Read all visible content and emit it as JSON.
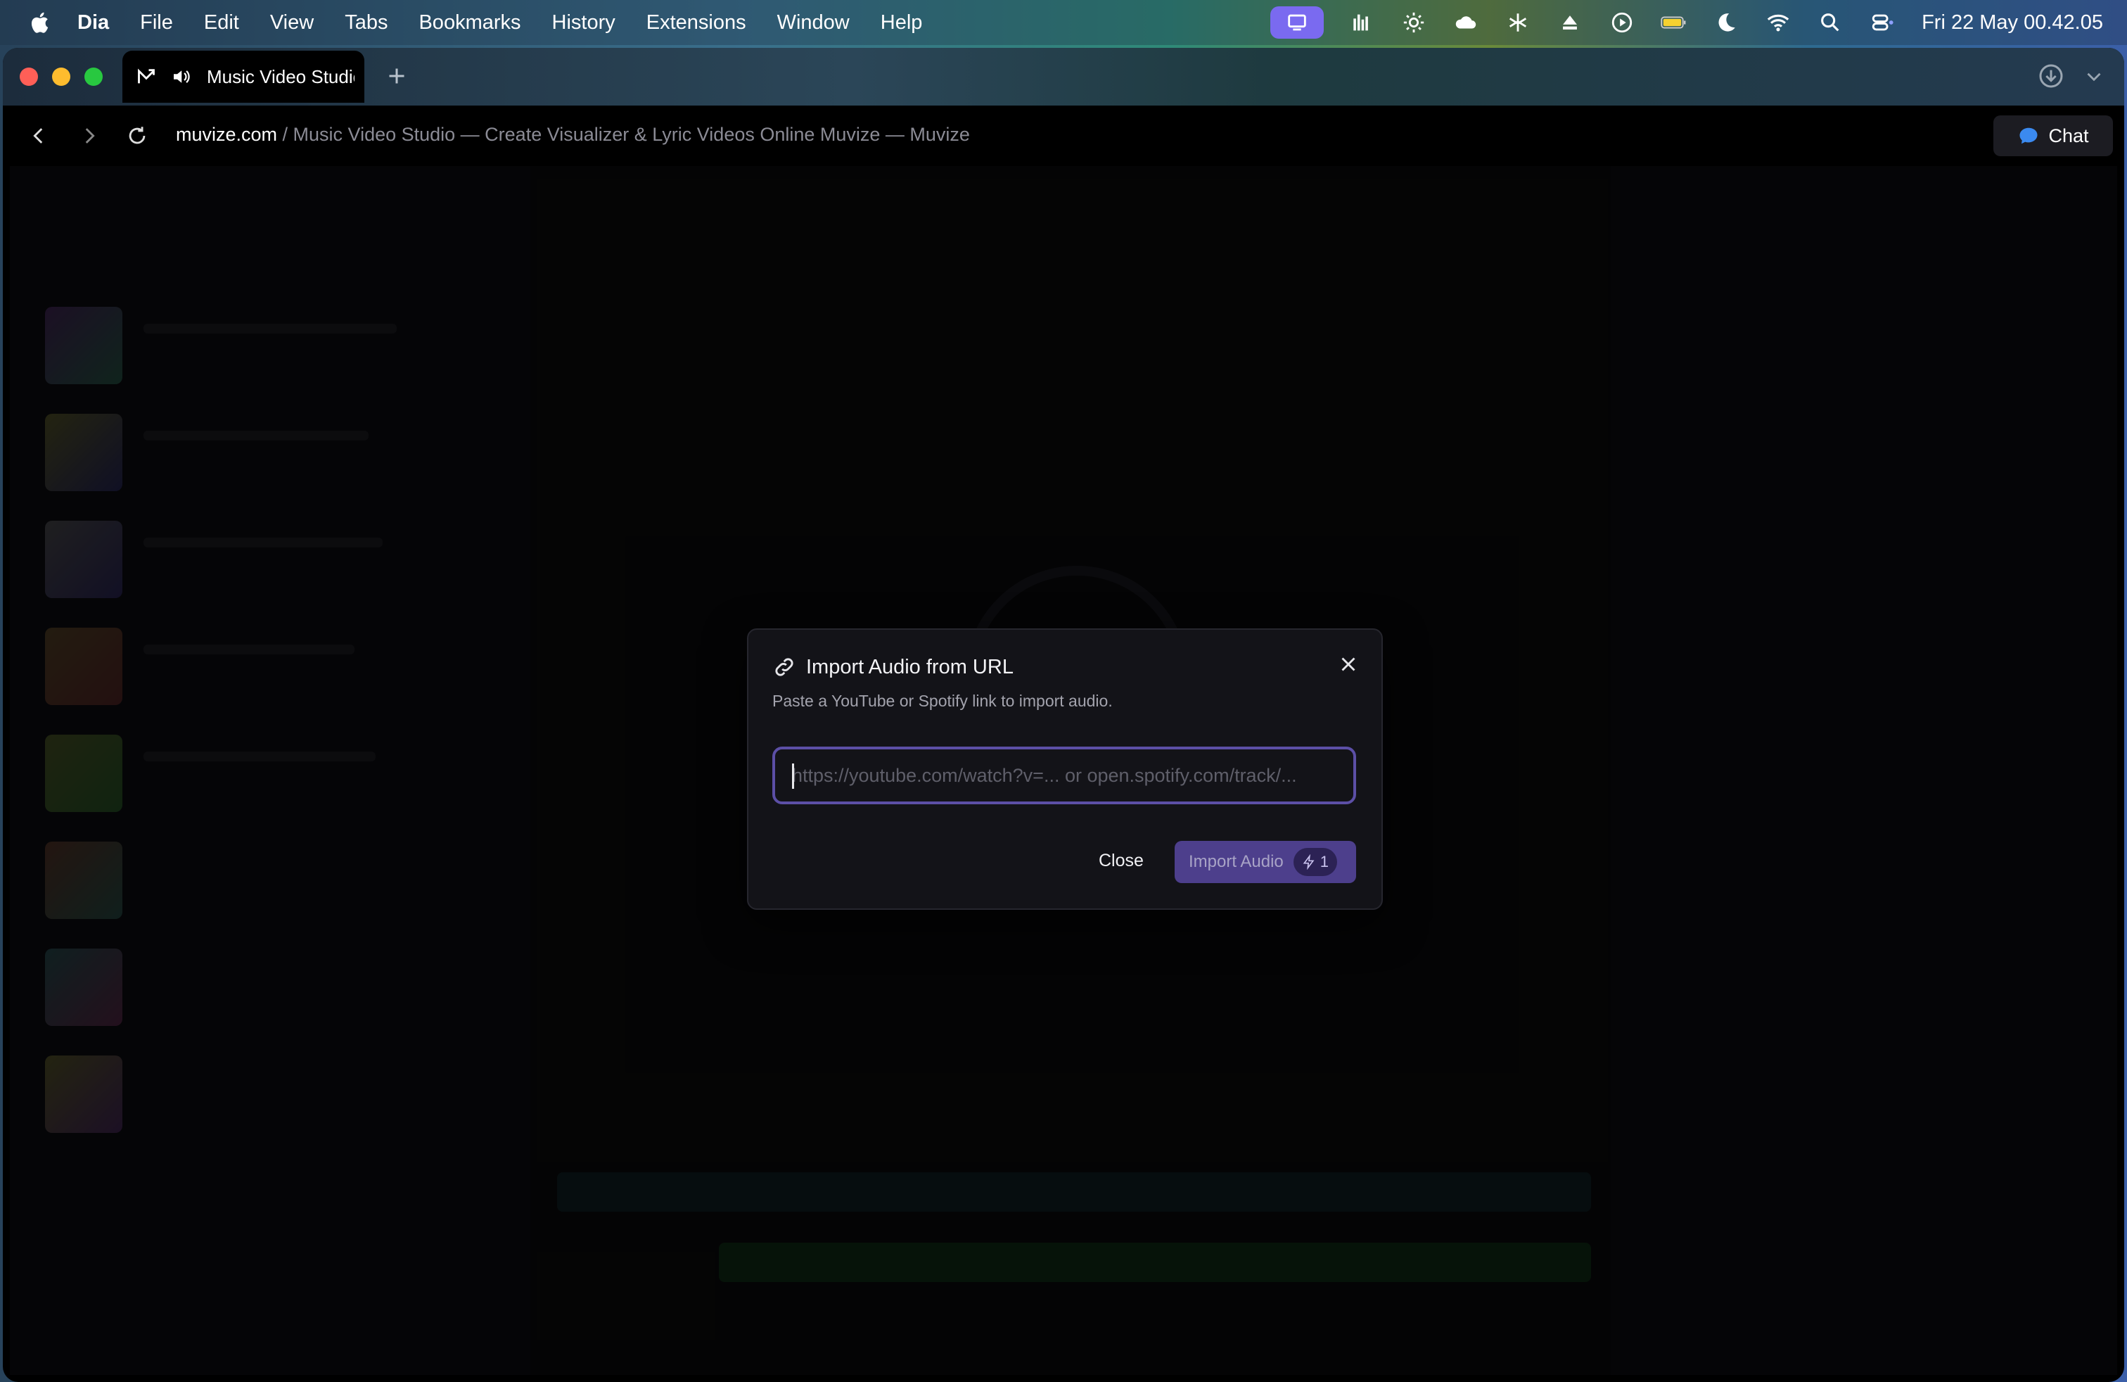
{
  "menubar": {
    "app_name": "Dia",
    "menus": [
      "File",
      "Edit",
      "View",
      "Tabs",
      "Bookmarks",
      "History",
      "Extensions",
      "Window",
      "Help"
    ],
    "clock": "Fri 22 May  00.42.05"
  },
  "browser": {
    "tab_title": "Music Video Studio",
    "url_domain": "muvize.com",
    "url_path": " / Music Video Studio — Create Visualizer & Lyric Videos Online Muvize — Muvize",
    "chat_label": "Chat"
  },
  "modal": {
    "title": "Import Audio from URL",
    "subtitle": "Paste a YouTube or Spotify link to import audio.",
    "input_value": "",
    "input_placeholder": "https://youtube.com/watch?v=... or open.spotify.com/track/...",
    "close_label": "Close",
    "import_label": "Import Audio",
    "credit_cost": "1"
  },
  "colors": {
    "accent": "#5c4fa6",
    "import_button": "#4d3f8c",
    "modal_bg": "#131318"
  }
}
